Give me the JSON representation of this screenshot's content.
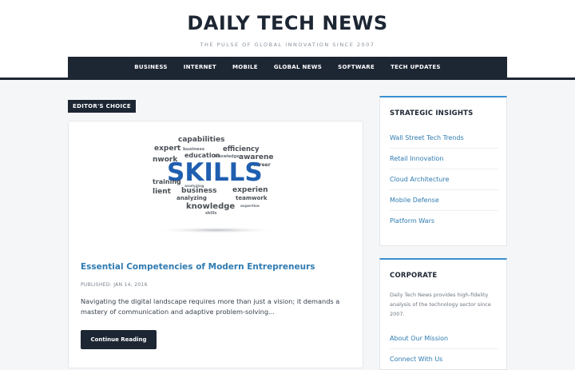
{
  "site": {
    "title": "DAILY TECH NEWS",
    "tagline": "THE PULSE OF GLOBAL INNOVATION SINCE 2007"
  },
  "nav": {
    "items": [
      "BUSINESS",
      "INTERNET",
      "MOBILE",
      "GLOBAL NEWS",
      "SOFTWARE",
      "TECH UPDATES"
    ]
  },
  "featured": {
    "badge": "EDITOR'S CHOICE",
    "image_words": {
      "main": "SKILLS",
      "words": [
        "capabilities",
        "expert",
        "efficiency",
        "business",
        "education",
        "awarene",
        "nwork",
        "knowledge",
        "career",
        "training",
        "analyzing",
        "lient",
        "experien",
        "teamwork",
        "knowledge",
        "expertise",
        "skills"
      ]
    },
    "title": "Essential Competencies of Modern Entrepreneurs",
    "meta": "PUBLISHED: JAN 14, 2016",
    "excerpt": "Navigating the digital landscape requires more than just a vision; it demands a mastery of communication and adaptive problem-solving...",
    "button": "Continue Reading"
  },
  "sidebar": {
    "insights": {
      "title": "STRATEGIC INSIGHTS",
      "items": [
        "Wall Street Tech Trends",
        "Retail Innovation",
        "Cloud Architecture",
        "Mobile Defense",
        "Platform Wars"
      ]
    },
    "corporate": {
      "title": "CORPORATE",
      "text": "Daily Tech News provides high-fidelity analysis of the technology sector since 2007.",
      "links": [
        "About Our Mission",
        "Connect With Us"
      ]
    }
  },
  "colors": {
    "navy": "#1d2633",
    "link": "#2f7bb1",
    "accent": "#3a8fd1"
  }
}
